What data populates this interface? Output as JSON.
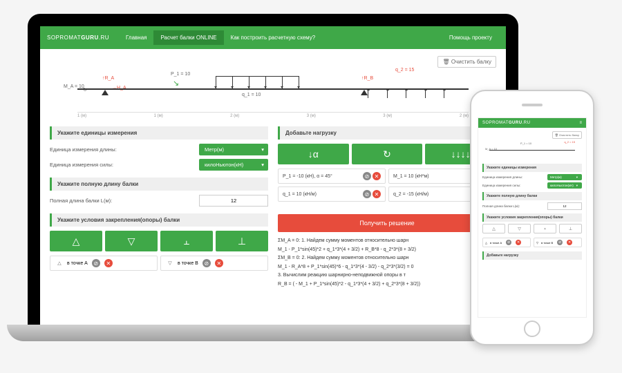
{
  "brand": {
    "prefix": "SOPROMAT",
    "bold": "GURU",
    "suffix": ".RU"
  },
  "nav": {
    "home": "Главная",
    "calc": "Расчет балки ONLINE",
    "howto": "Как построить расчетную схему?",
    "help": "Помощь проекту"
  },
  "clear_button": "Очистить балку",
  "beam": {
    "M_A": "M_A = 10",
    "R_A": "R_A",
    "H_A": "H_A",
    "P1": "P_1 = 10",
    "q1": "q_1 = 10",
    "q2": "q_2 = 15",
    "R_B": "R_B",
    "ruler": [
      "1 (м)",
      "1 (м)",
      "2 (м)",
      "3 (м)",
      "3 (м)",
      "2 (м)"
    ]
  },
  "units": {
    "header": "Укажите единицы измерения",
    "length_label": "Единица измерения длины:",
    "length_value": "Метр(м)",
    "force_label": "Единица измерения силы:",
    "force_value": "килоНьютон(кН)"
  },
  "length": {
    "header": "Укажите полную длину балки",
    "label": "Полная длина балки L(м):",
    "value": "12"
  },
  "supports": {
    "header": "Укажите условия закрепления(опоры) балки",
    "a_text": "в точке А",
    "b_text": "в точке B"
  },
  "loads": {
    "header": "Добавьте нагрузку",
    "p1": "P_1 = -10 (кН), α = 45°",
    "m1": "M_1 = 10 (кН*м)",
    "q1": "q_1 = 10 (кН/м)",
    "q2": "q_2 = -15 (кН/м)"
  },
  "solve": "Получить решение",
  "math": {
    "l1": "ΣM_A = 0:   1. Найдем сумму моментов относительно шарн",
    "l2": "M_1 - P_1*sin(45)*2 + q_1*3*(4 + 3/2) + R_B*8 - q_2*3*(8 + 3/2)",
    "l3": "ΣM_B = 0:   2. Найдем сумму моментов относительно шарн",
    "l4": "M_1 - R_A*8 + P_1*sin(45)*6 - q_1*3*(4 - 3/2) - q_2*3*(3/2) = 0",
    "l5": "3. Вычислим реакцию шарнирно-неподвижной опоры в т",
    "l6": "R_B = ( - M_1 + P_1*sin(45)*2 - q_1*3*(4 + 3/2) + q_2*3*(8 + 3/2))"
  }
}
